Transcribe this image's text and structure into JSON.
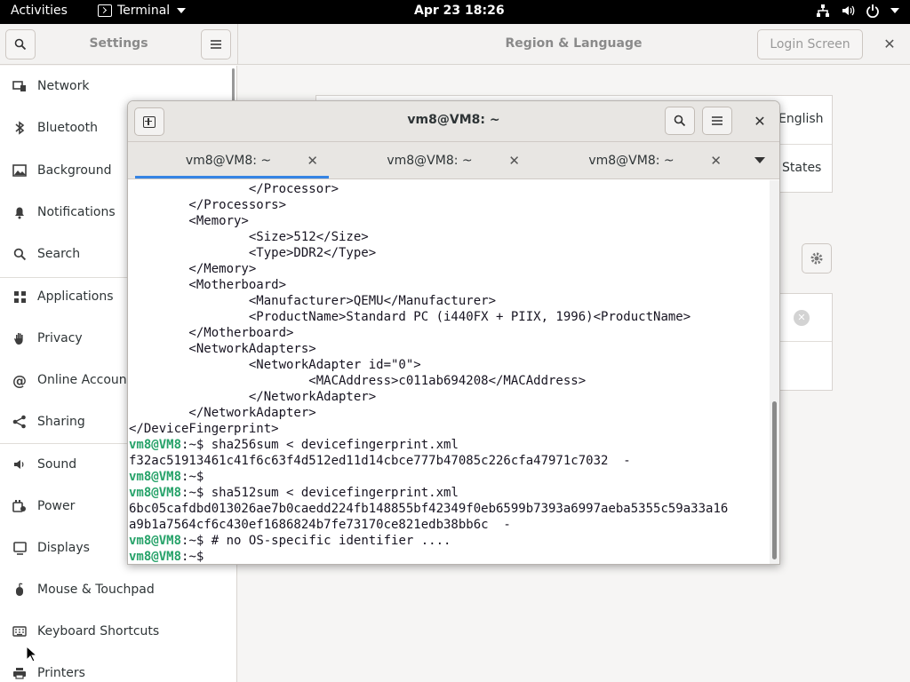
{
  "topbar": {
    "activities": "Activities",
    "app_name": "Terminal",
    "clock": "Apr 23  18:26"
  },
  "settings": {
    "title": "Settings",
    "panel_title": "Region & Language",
    "login_screen": "Login Screen",
    "sidebar": [
      {
        "label": "Network",
        "icon": "network-icon"
      },
      {
        "label": "Bluetooth",
        "icon": "bluetooth-icon"
      },
      {
        "label": "Background",
        "icon": "background-icon"
      },
      {
        "label": "Notifications",
        "icon": "bell-icon"
      },
      {
        "label": "Search",
        "icon": "search-icon"
      },
      {
        "label": "Applications",
        "icon": "apps-grid-icon"
      },
      {
        "label": "Privacy",
        "icon": "hand-icon"
      },
      {
        "label": "Online Accounts",
        "icon": "at-icon"
      },
      {
        "label": "Sharing",
        "icon": "share-icon"
      },
      {
        "label": "Sound",
        "icon": "speaker-icon"
      },
      {
        "label": "Power",
        "icon": "power-icon"
      },
      {
        "label": "Displays",
        "icon": "display-icon"
      },
      {
        "label": "Mouse & Touchpad",
        "icon": "mouse-icon"
      },
      {
        "label": "Keyboard Shortcuts",
        "icon": "keyboard-icon"
      },
      {
        "label": "Printers",
        "icon": "printer-icon"
      }
    ],
    "region": {
      "language_value": "English",
      "formats_value": "States"
    }
  },
  "terminal": {
    "title": "vm8@VM8: ~",
    "tabs": [
      "vm8@VM8: ~",
      "vm8@VM8: ~",
      "vm8@VM8: ~"
    ],
    "prompt_user": "vm8@VM8",
    "prompt_rest": ":~$",
    "lines": [
      {
        "text": "                </Processor>"
      },
      {
        "text": "        </Processors>"
      },
      {
        "text": "        <Memory>"
      },
      {
        "text": "                <Size>512</Size>"
      },
      {
        "text": "                <Type>DDR2</Type>"
      },
      {
        "text": "        </Memory>"
      },
      {
        "text": "        <Motherboard>"
      },
      {
        "text": "                <Manufacturer>QEMU</Manufacturer>"
      },
      {
        "text": "                <ProductName>Standard PC (i440FX + PIIX, 1996)<ProductName>"
      },
      {
        "text": "        </Motherboard>"
      },
      {
        "text": "        <NetworkAdapters>"
      },
      {
        "text": "                <NetworkAdapter id=\"0\">"
      },
      {
        "text": "                        <MACAddress>c011ab694208</MACAddress>"
      },
      {
        "text": "                </NetworkAdapter>"
      },
      {
        "text": "        </NetworkAdapter>"
      },
      {
        "text": "</DeviceFingerprint>"
      },
      {
        "prompt": true,
        "text": " sha256sum < devicefingerprint.xml"
      },
      {
        "text": "f32ac51913461c41f6c63f4d512ed11d14cbce777b47085c226cfa47971c7032  -"
      },
      {
        "prompt": true,
        "text": ""
      },
      {
        "prompt": true,
        "text": " sha512sum < devicefingerprint.xml"
      },
      {
        "text": "6bc05cafdbd013026ae7b0caedd224fb148855bf42349f0eb6599b7393a6997aeba5355c59a33a16"
      },
      {
        "text": "a9b1a7564cf6c430ef1686824b7fe73170ce821edb38bb6c  -"
      },
      {
        "prompt": true,
        "text": " # no OS-specific identifier ...."
      },
      {
        "prompt": true,
        "text": " "
      }
    ]
  },
  "colors": {
    "prompt_green": "#26a269",
    "tab_accent": "#3584e4",
    "topbar_bg": "#000000"
  }
}
